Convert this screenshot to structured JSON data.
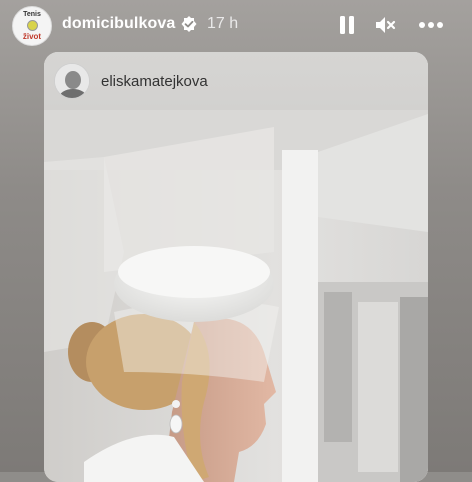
{
  "story": {
    "username": "domicibulkova",
    "timestamp": "17 h",
    "avatar_text_line1": "Tenis",
    "avatar_text_line2": "život"
  },
  "shared_post": {
    "username": "eliskamatejkova"
  },
  "icons": {
    "verified": "verified-badge-icon",
    "pause": "pause-icon",
    "mute": "speaker-muted-icon",
    "more": "more-options-icon"
  },
  "colors": {
    "header_text": "#ffffff",
    "background": "#8f8d8a",
    "card_header": "#d6d5d3"
  }
}
